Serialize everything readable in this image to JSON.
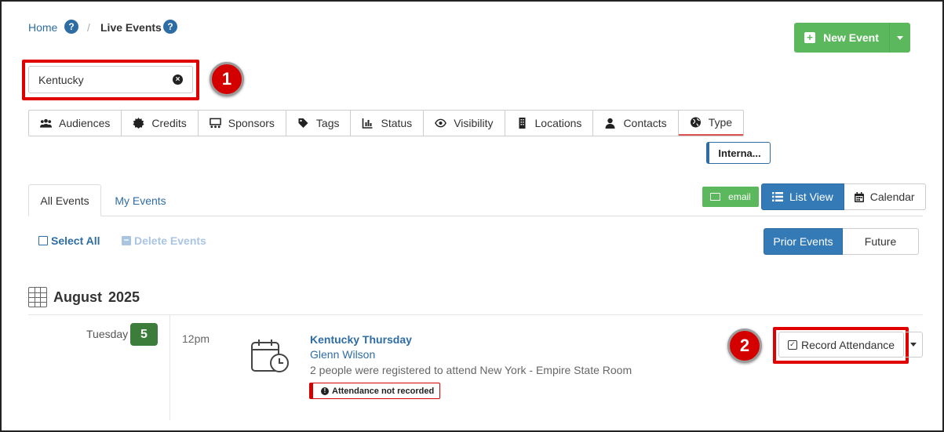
{
  "breadcrumb": {
    "home": "Home",
    "current": "Live Events",
    "help": "?",
    "separator": "/"
  },
  "new_event": {
    "label": "New Event"
  },
  "search": {
    "value": "Kentucky"
  },
  "callouts": [
    "1",
    "2"
  ],
  "filters": [
    {
      "label": "Audiences",
      "icon": "users-icon"
    },
    {
      "label": "Credits",
      "icon": "certificate-icon"
    },
    {
      "label": "Sponsors",
      "icon": "sponsors-icon"
    },
    {
      "label": "Tags",
      "icon": "tag-icon"
    },
    {
      "label": "Status",
      "icon": "bar-chart-icon"
    },
    {
      "label": "Visibility",
      "icon": "eye-icon"
    },
    {
      "label": "Locations",
      "icon": "building-icon"
    },
    {
      "label": "Contacts",
      "icon": "user-icon"
    },
    {
      "label": "Type",
      "icon": "globe-icon"
    }
  ],
  "type_chip": "Interna...",
  "tabs": {
    "all": "All Events",
    "mine": "My Events"
  },
  "toolbar": {
    "email": "email",
    "list_view": "List View",
    "calendar": "Calendar",
    "select_all": "Select All",
    "delete": "Delete Events",
    "prior": "Prior Events",
    "future": "Future"
  },
  "month": {
    "name": "August",
    "year": "2025"
  },
  "event": {
    "day_of_week": "Tuesday",
    "day": "5",
    "time": "12pm",
    "title": "Kentucky Thursday",
    "host": "Glenn Wilson",
    "description": "2 people were registered to attend New York - Empire State Room",
    "status": "Attendance not recorded",
    "action": "Record Attendance"
  },
  "colors": {
    "primary": "#337ab7",
    "success": "#5cb85c",
    "highlight": "#e00000",
    "day_badge": "#3c7d3c"
  }
}
